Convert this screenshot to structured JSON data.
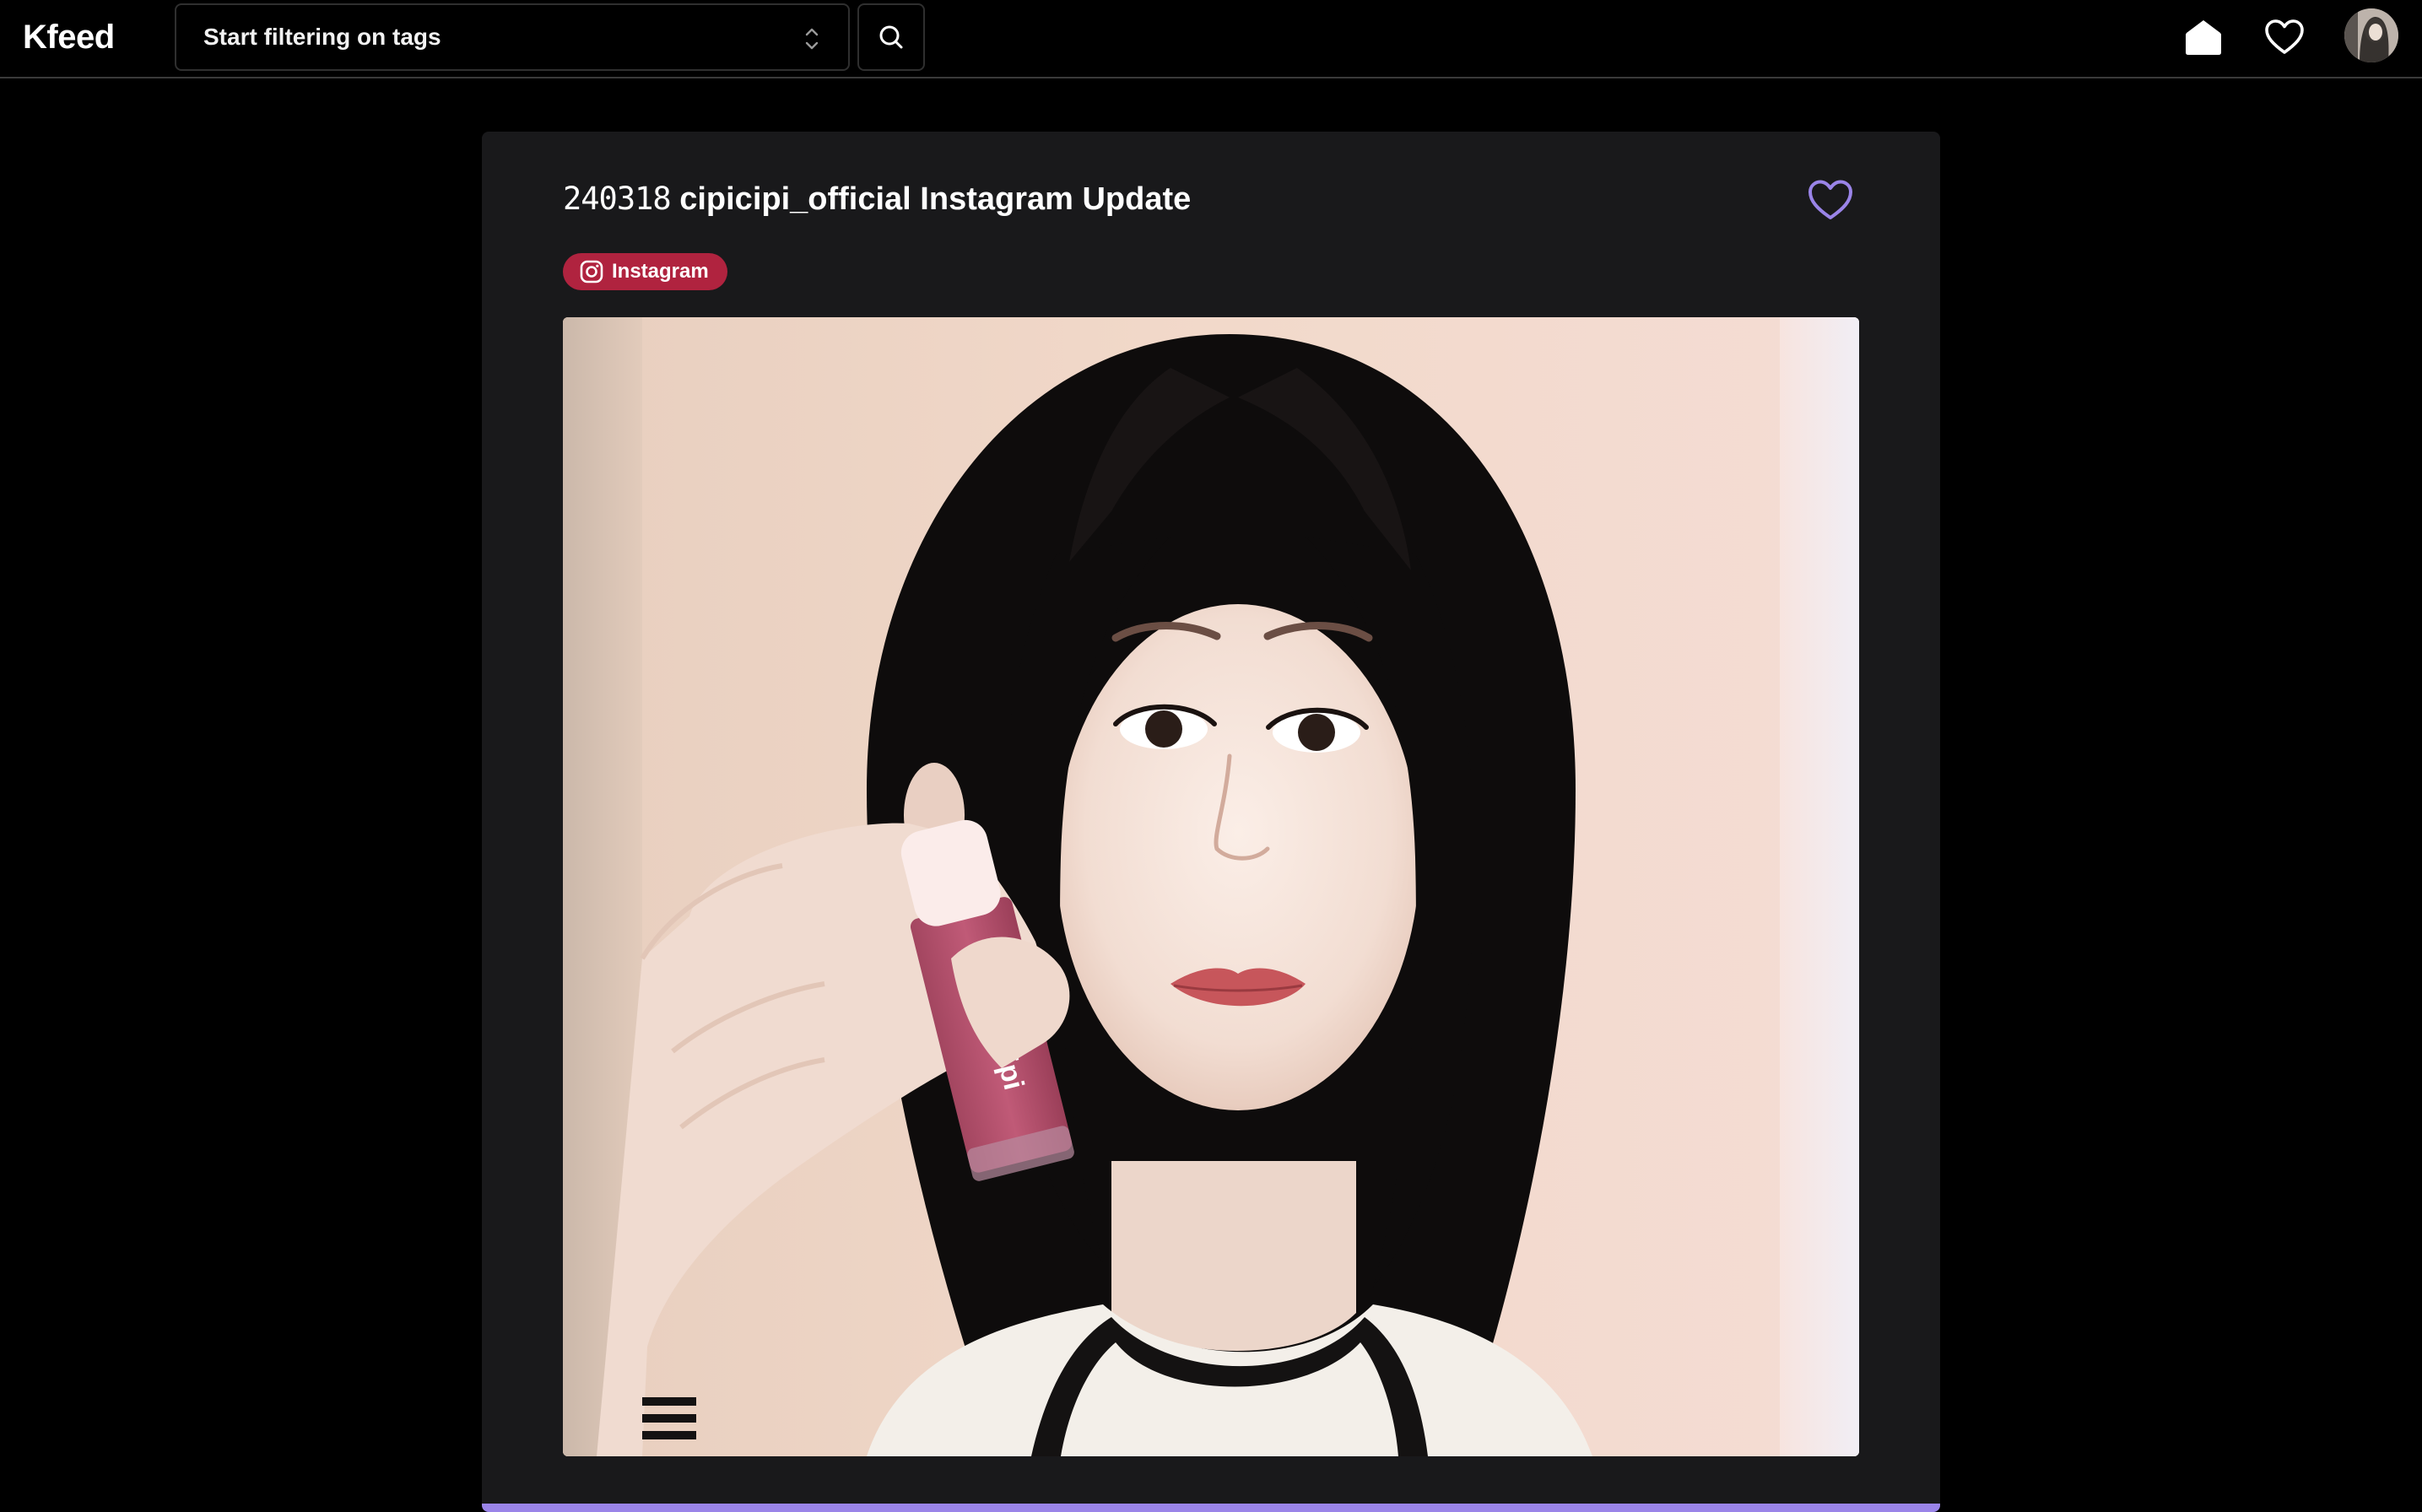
{
  "app": {
    "logo": "Kfeed"
  },
  "header": {
    "tag_filter_placeholder": "Start filtering on tags",
    "icons": {
      "search": "search-icon",
      "home": "home-icon",
      "favorites": "heart-icon",
      "avatar": "user-avatar"
    }
  },
  "post": {
    "date": "240318",
    "title": "cipicipi_official Instagram Update",
    "source_tag": {
      "label": "Instagram",
      "icon": "instagram-icon",
      "color": "#b0233f"
    },
    "like_icon": "heart-outline-icon",
    "product_text": "CipiCipi"
  },
  "colors": {
    "background": "#000000",
    "card": "#19191b",
    "accent": "#9a84e8",
    "tag": "#b0233f"
  }
}
